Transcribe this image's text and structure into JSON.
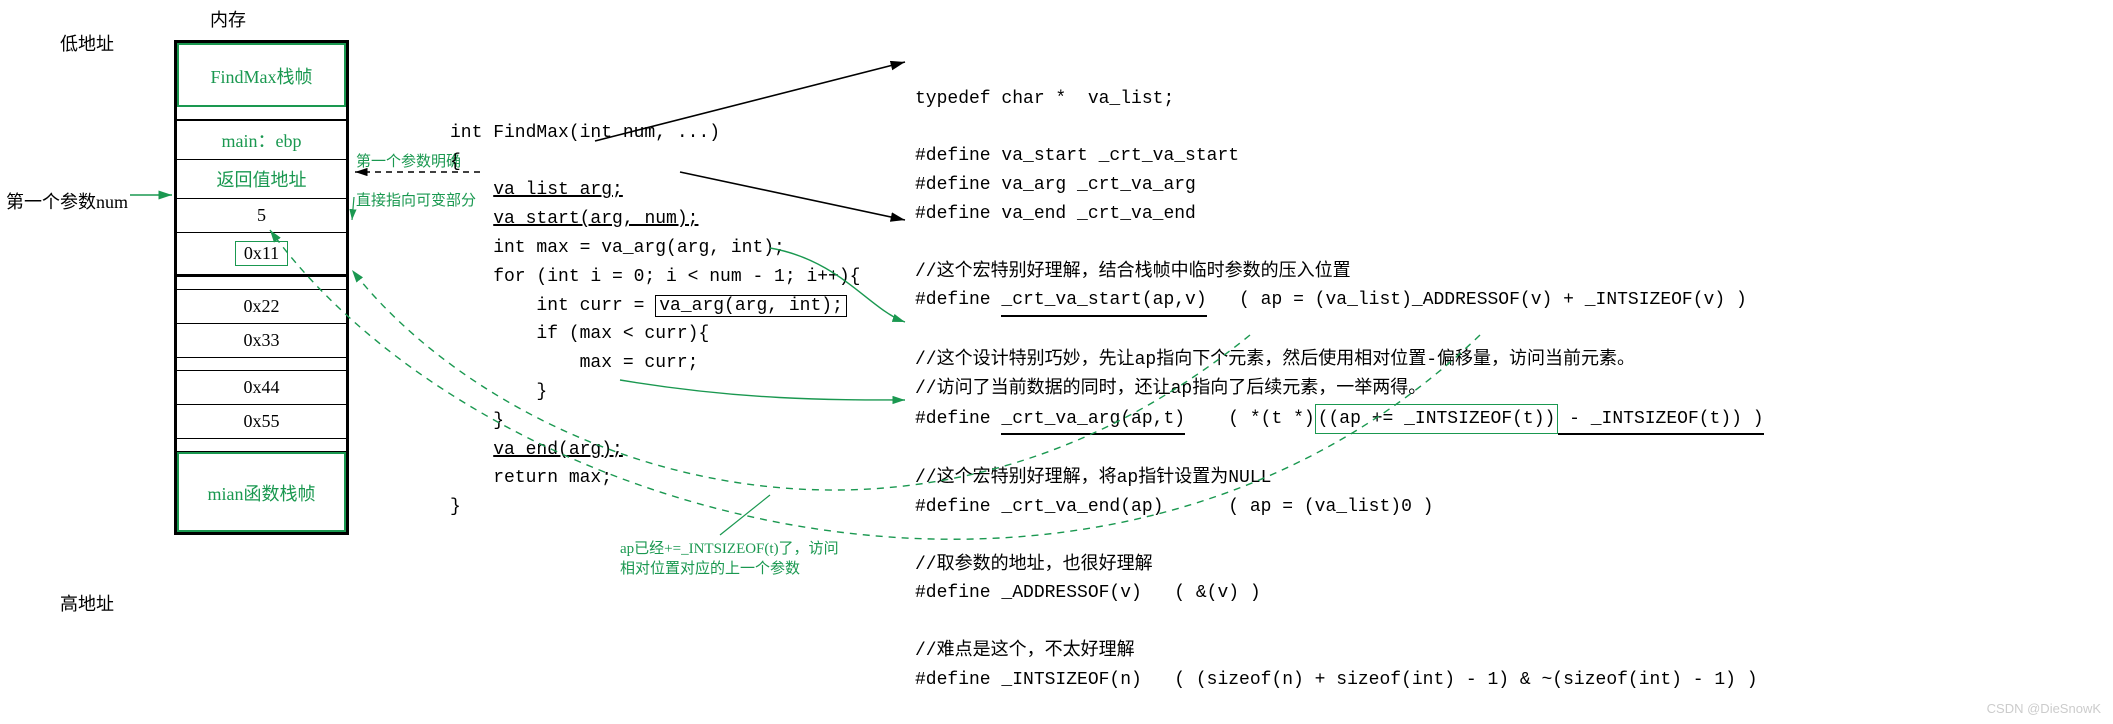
{
  "labels": {
    "memory": "内存",
    "lowaddr": "低地址",
    "highaddr": "高地址",
    "firstparam": "第一个参数num",
    "firstparam_note": "第一个参数明确",
    "direct_ptr_note": "直接指向可变部分",
    "ap_note1": "ap已经+=_INTSIZEOF(t)了，访问",
    "ap_note2": "相对位置对应的上一个参数",
    "watermark": "CSDN @DieSnowK"
  },
  "stack": {
    "findmax": "FindMax栈帧",
    "mainebp": "main：ebp",
    "retaddr": "返回值地址",
    "five": "5",
    "ox11": "0x11",
    "ox22": "0x22",
    "ox33": "0x33",
    "ox44": "0x44",
    "ox55": "0x55",
    "mainframe": "mian函数栈帧"
  },
  "code": {
    "l1": "int FindMax(int num, ...)",
    "l2": "{",
    "l3": "    va_list arg;",
    "l3u": "va_list arg;",
    "l4": "    va_start(arg, num);",
    "l4u": "va_start(arg, num);",
    "l5": "    int max = va_arg(arg, int);",
    "l6": "    for (int i = 0; i < num - 1; i++){",
    "l7a": "        int curr = ",
    "l7b": "va_arg(arg, int);",
    "l8": "        if (max < curr){",
    "l9": "            max = curr;",
    "l10": "        }",
    "l11": "    }",
    "l12": "    va_end(arg);",
    "l12u": "va_end(arg);",
    "l13": "    return max;",
    "l14": "}"
  },
  "right": {
    "r1": "typedef char *  va_list;",
    "r2": "#define va_start _crt_va_start",
    "r3": "#define va_arg _crt_va_arg",
    "r4": "#define va_end _crt_va_end",
    "c1": "//这个宏特别好理解，结合栈帧中临时参数的压入位置",
    "d1a": "#define ",
    "d1b": "_crt_va_start(ap,v)",
    "d1c": "   ( ap = (va_list)_ADDRESSOF(v) + _INTSIZEOF(v) )",
    "c2": "//这个设计特别巧妙，先让ap指向下个元素，然后使用相对位置-偏移量，访问当前元素。",
    "c3": "//访问了当前数据的同时，还让ap指向了后续元素，一举两得。",
    "d2a": "#define ",
    "d2b": "_crt_va_arg(ap,t)",
    "d2c": "    ( *(t *)",
    "d2d": "((ap += _INTSIZEOF(t))",
    "d2e": " - _INTSIZEOF(t)) )",
    "c4": "//这个宏特别好理解，将ap指针设置为NULL",
    "d3": "#define _crt_va_end(ap)      ( ap = (va_list)0 )",
    "c5": "//取参数的地址，也很好理解",
    "d4": "#define _ADDRESSOF(v)   ( &(v) )",
    "c6": "//难点是这个，不太好理解",
    "d5": "#define _INTSIZEOF(n)   ( (sizeof(n) + sizeof(int) - 1) & ~(sizeof(int) - 1) )"
  }
}
